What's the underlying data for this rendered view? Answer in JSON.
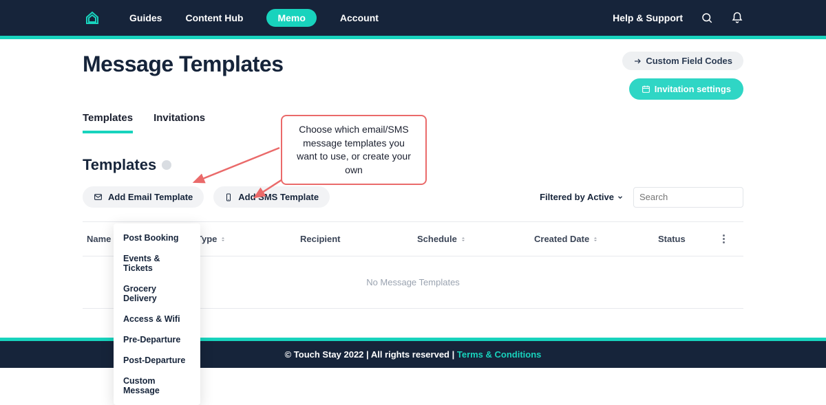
{
  "nav": {
    "items": [
      "Guides",
      "Content Hub",
      "Memo",
      "Account"
    ],
    "active_index": 2,
    "help_label": "Help & Support"
  },
  "header": {
    "title": "Message Templates",
    "custom_codes_label": "Custom Field Codes",
    "invitation_settings_label": "Invitation settings"
  },
  "tabs": {
    "items": [
      "Templates",
      "Invitations"
    ],
    "active_index": 0
  },
  "section": {
    "title": "Templates"
  },
  "toolbar": {
    "add_email_label": "Add Email Template",
    "add_sms_label": "Add SMS Template",
    "filter_label": "Filtered by Active",
    "search_placeholder": "Search"
  },
  "dropdown": {
    "items": [
      "Post Booking",
      "Events & Tickets",
      "Grocery Delivery",
      "Access & Wifi",
      "Pre-Departure",
      "Post-Departure",
      "Custom Message"
    ]
  },
  "table": {
    "columns": [
      "Name",
      "Type",
      "Recipient",
      "Schedule",
      "Created Date",
      "Status"
    ],
    "empty_message": "No Message Templates"
  },
  "annotation": {
    "text": "Choose which email/SMS message templates you want to use, or create your own"
  },
  "footer": {
    "copyright": "© Touch Stay 2022",
    "rights": "All rights reserved",
    "terms_label": "Terms & Conditions"
  }
}
